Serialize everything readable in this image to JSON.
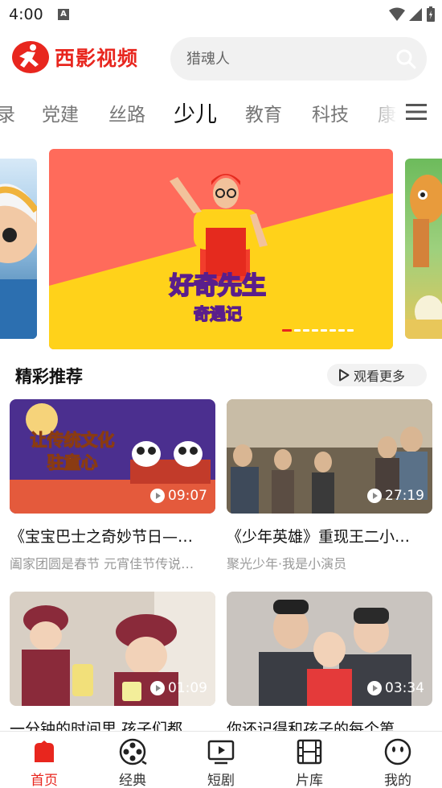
{
  "status": {
    "time": "4:00",
    "notif_letter": "A"
  },
  "brand": {
    "name": "西影视频",
    "color": "#e8261e"
  },
  "search": {
    "placeholder": "猎魂人"
  },
  "tabs": [
    {
      "label": "录",
      "active": false
    },
    {
      "label": "党建",
      "active": false
    },
    {
      "label": "丝路",
      "active": false
    },
    {
      "label": "少儿",
      "active": true
    },
    {
      "label": "教育",
      "active": false
    },
    {
      "label": "科技",
      "active": false
    },
    {
      "label": "康",
      "active": false
    }
  ],
  "banner": {
    "title_line1": "好奇先生",
    "title_line2": "奇遇记",
    "active_dot": 0,
    "dot_count": 8
  },
  "section": {
    "title": "精彩推荐",
    "more_label": "观看更多"
  },
  "cards": [
    {
      "title": "《宝宝巴士之奇妙节日—…",
      "subtitle": "阖家团圆是春节 元宵佳节传说…",
      "duration": "09:07",
      "overlay_line1": "让传统文化",
      "overlay_line2": "驻童心"
    },
    {
      "title": "《少年英雄》重现王二小…",
      "subtitle": "聚光少年·我是小演员",
      "duration": "27:19"
    },
    {
      "title": "一分钟的时间里 孩子们都…",
      "subtitle": "",
      "duration": "01:09"
    },
    {
      "title": "你还记得和孩子的每个第…",
      "subtitle": "",
      "duration": "03:34"
    }
  ],
  "nav": [
    {
      "label": "首页",
      "icon": "home-icon",
      "active": true
    },
    {
      "label": "经典",
      "icon": "film-reel-icon",
      "active": false
    },
    {
      "label": "短剧",
      "icon": "play-screen-icon",
      "active": false
    },
    {
      "label": "片库",
      "icon": "film-strip-icon",
      "active": false
    },
    {
      "label": "我的",
      "icon": "profile-face-icon",
      "active": false
    }
  ]
}
